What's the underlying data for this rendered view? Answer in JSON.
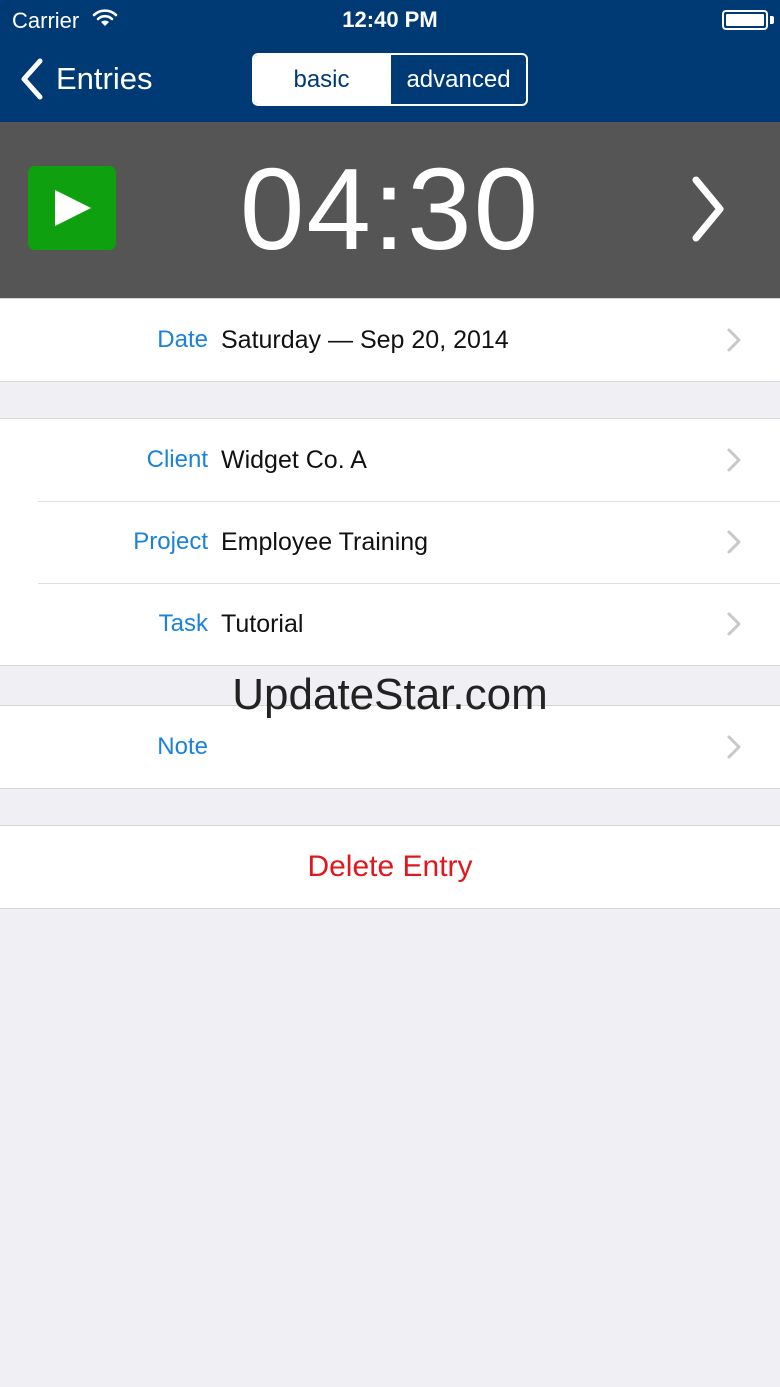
{
  "status": {
    "carrier": "Carrier",
    "time": "12:40 PM"
  },
  "nav": {
    "back_label": "Entries",
    "segments": [
      "basic",
      "advanced"
    ],
    "selected_segment": "basic"
  },
  "timer": {
    "display": "04:30"
  },
  "date_row": {
    "label": "Date",
    "value": "Saturday — Sep 20, 2014"
  },
  "details": {
    "client": {
      "label": "Client",
      "value": "Widget Co. A"
    },
    "project": {
      "label": "Project",
      "value": "Employee Training"
    },
    "task": {
      "label": "Task",
      "value": "Tutorial"
    }
  },
  "note_row": {
    "label": "Note",
    "value": ""
  },
  "delete_label": "Delete Entry",
  "watermark": "UpdateStar.com",
  "colors": {
    "nav_bar": "#003a75",
    "timer_bar": "#555555",
    "play_button": "#0fa00f",
    "label_blue": "#1a82db",
    "delete_red": "#e0181e"
  }
}
